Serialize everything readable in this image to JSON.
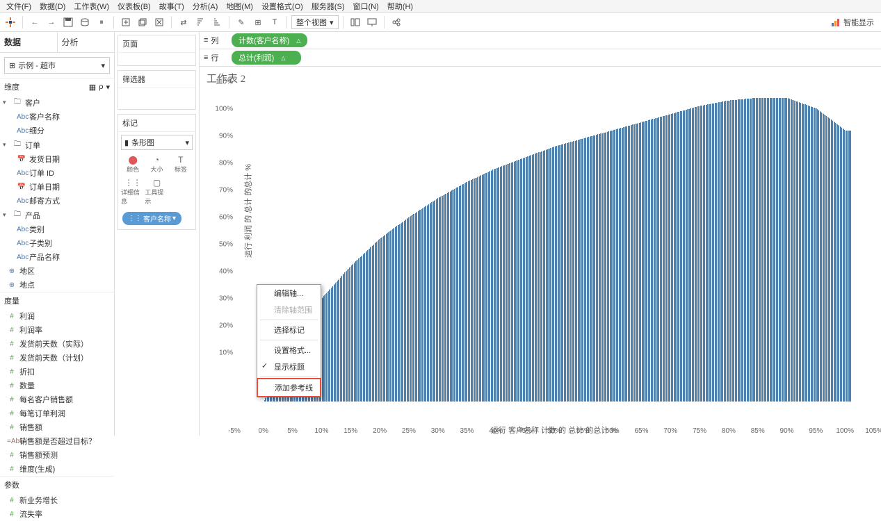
{
  "menu": [
    "文件(F)",
    "数据(D)",
    "工作表(W)",
    "仪表板(B)",
    "故事(T)",
    "分析(A)",
    "地图(M)",
    "设置格式(O)",
    "服务器(S)",
    "窗口(N)",
    "帮助(H)"
  ],
  "show_me": "智能显示",
  "view_mode": "整个视图",
  "side": {
    "tab_data": "数据",
    "tab_analysis": "分析",
    "datasource": "示例 - 超市",
    "hdr_dim": "维度",
    "hdr_meas": "度量",
    "hdr_param": "参数",
    "dims": [
      {
        "t": "g",
        "l": "客户"
      },
      {
        "t": "abc",
        "l": "客户名称",
        "s": 1
      },
      {
        "t": "abc",
        "l": "细分",
        "s": 1
      },
      {
        "t": "g",
        "l": "订单"
      },
      {
        "t": "date",
        "l": "发货日期",
        "s": 1
      },
      {
        "t": "abc",
        "l": "订单 ID",
        "s": 1
      },
      {
        "t": "date",
        "l": "订单日期",
        "s": 1
      },
      {
        "t": "abc",
        "l": "邮寄方式",
        "s": 1
      },
      {
        "t": "g",
        "l": "产品"
      },
      {
        "t": "abc",
        "l": "类别",
        "s": 1
      },
      {
        "t": "abc",
        "l": "子类别",
        "s": 1
      },
      {
        "t": "abc",
        "l": "产品名称",
        "s": 1
      },
      {
        "t": "geo",
        "l": "地区"
      },
      {
        "t": "geo",
        "l": "地点"
      }
    ],
    "meas": [
      {
        "t": "num",
        "l": "利润"
      },
      {
        "t": "num",
        "l": "利润率"
      },
      {
        "t": "num",
        "l": "发货前天数（实际）"
      },
      {
        "t": "num",
        "l": "发货前天数（计划）"
      },
      {
        "t": "num",
        "l": "折扣"
      },
      {
        "t": "num",
        "l": "数量"
      },
      {
        "t": "num",
        "l": "每名客户销售额"
      },
      {
        "t": "num",
        "l": "每笔订单利润"
      },
      {
        "t": "num",
        "l": "销售额"
      },
      {
        "t": "calc",
        "l": "销售额是否超过目标？"
      },
      {
        "t": "num",
        "l": "销售额预测"
      },
      {
        "t": "num",
        "l": "维度(生成)"
      }
    ],
    "params": [
      {
        "t": "num",
        "l": "新业务增长"
      },
      {
        "t": "num",
        "l": "流失率"
      }
    ]
  },
  "cards": {
    "pages": "页面",
    "filters": "筛选器",
    "marks": "标记",
    "mark_type": "条形图",
    "mark_cells": [
      "颜色",
      "大小",
      "标签",
      "详细信息",
      "工具提示"
    ],
    "mark_pill": "客户名称"
  },
  "shelves": {
    "col_label": "列",
    "col_pill": "计数(客户名称)",
    "row_label": "行",
    "row_pill": "总计(利润)"
  },
  "ws_title": "工作表 2",
  "ctx": {
    "edit_axis": "编辑轴...",
    "clear_range": "清除轴范围",
    "select_marks": "选择标记",
    "format": "设置格式...",
    "show_title": "显示标题",
    "add_ref": "添加参考线"
  },
  "chart_data": {
    "type": "bar",
    "xlabel": "运行 客户名称 计数 的 总计 的总计 %",
    "ylabel": "运行 利润 的 总计 的总计 %",
    "xlim": [
      -5,
      105
    ],
    "ylim": [
      -5,
      115
    ],
    "x_ticks": [
      -5,
      0,
      5,
      10,
      15,
      20,
      25,
      30,
      35,
      40,
      45,
      50,
      55,
      60,
      65,
      70,
      75,
      80,
      85,
      90,
      95,
      100,
      105
    ],
    "y_ticks": [
      10,
      20,
      30,
      40,
      50,
      60,
      70,
      80,
      90,
      100,
      110
    ],
    "series_note": "Pareto-style running total of profit vs running count of customers; hundreds of bars approximating a concave curve that rises steeply early, crosses 100% near x≈80%, peaks ~112% near x≈85–90%, then declines back toward ~100% at x=100%. Negative-profit customers at left shown as light bars below/near 0.",
    "curve_samples": [
      {
        "x": -3,
        "y": -2
      },
      {
        "x": 0,
        "y": 0
      },
      {
        "x": 5,
        "y": 22
      },
      {
        "x": 10,
        "y": 38
      },
      {
        "x": 15,
        "y": 50
      },
      {
        "x": 20,
        "y": 60
      },
      {
        "x": 25,
        "y": 68
      },
      {
        "x": 30,
        "y": 75
      },
      {
        "x": 35,
        "y": 81
      },
      {
        "x": 40,
        "y": 86
      },
      {
        "x": 45,
        "y": 90
      },
      {
        "x": 50,
        "y": 94
      },
      {
        "x": 55,
        "y": 97
      },
      {
        "x": 60,
        "y": 100
      },
      {
        "x": 65,
        "y": 103
      },
      {
        "x": 70,
        "y": 106
      },
      {
        "x": 75,
        "y": 109
      },
      {
        "x": 80,
        "y": 111
      },
      {
        "x": 85,
        "y": 112
      },
      {
        "x": 90,
        "y": 112
      },
      {
        "x": 95,
        "y": 108
      },
      {
        "x": 100,
        "y": 100
      }
    ]
  }
}
